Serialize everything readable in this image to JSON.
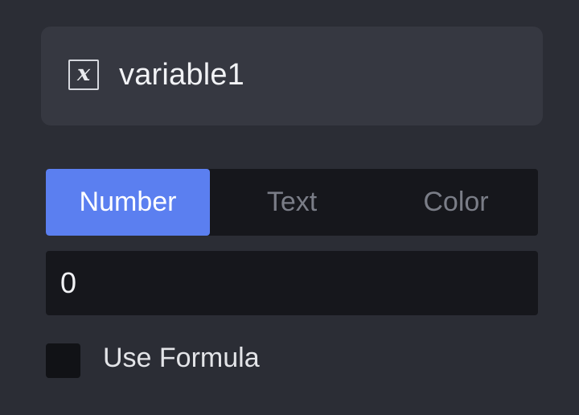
{
  "variable": {
    "icon": "variable-x-icon",
    "icon_glyph": "x",
    "name": "variable1"
  },
  "type_tabs": [
    {
      "label": "Number",
      "selected": true
    },
    {
      "label": "Text",
      "selected": false
    },
    {
      "label": "Color",
      "selected": false
    }
  ],
  "value_input": {
    "value": "0"
  },
  "use_formula": {
    "label": "Use Formula",
    "checked": false
  },
  "colors": {
    "background": "#2b2d35",
    "card": "#363841",
    "field": "#16171c",
    "accent": "#5b7ff0",
    "muted_text": "#7a7d87",
    "text": "#f1f2f5"
  }
}
